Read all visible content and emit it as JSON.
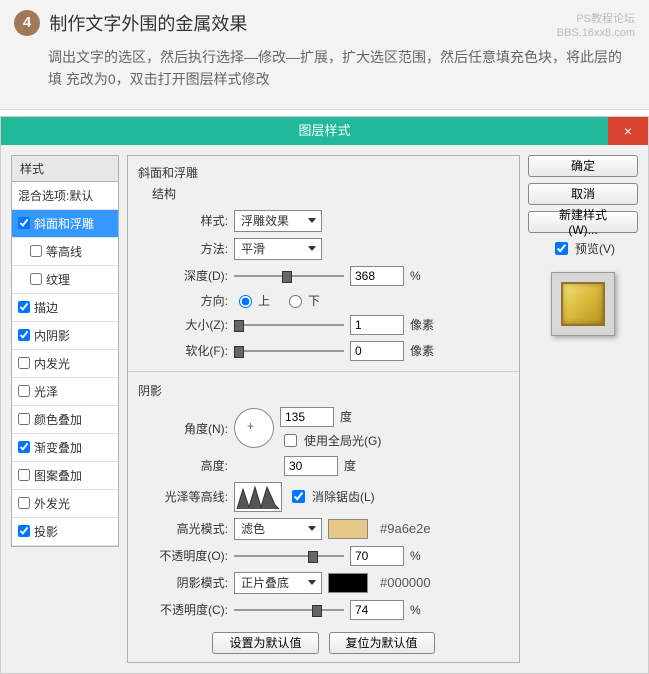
{
  "header": {
    "step_num": "4",
    "title": "制作文字外围的金属效果",
    "desc": "调出文字的选区，然后执行选择—修改—扩展，扩大选区范围，然后任意填充色块，将此层的填 充改为0，双击打开图层样式修改",
    "watermark1": "PS教程论坛",
    "watermark2": "BBS.16xx8.com"
  },
  "dialog": {
    "title": "图层样式",
    "close": "×"
  },
  "left": {
    "header": "样式",
    "blend": "混合选项:默认",
    "items": [
      {
        "label": "斜面和浮雕",
        "checked": true,
        "selected": true
      },
      {
        "label": "等高线",
        "checked": false,
        "sub": true
      },
      {
        "label": "纹理",
        "checked": false,
        "sub": true
      },
      {
        "label": "描边",
        "checked": true
      },
      {
        "label": "内阴影",
        "checked": true
      },
      {
        "label": "内发光",
        "checked": false
      },
      {
        "label": "光泽",
        "checked": false
      },
      {
        "label": "颜色叠加",
        "checked": false
      },
      {
        "label": "渐变叠加",
        "checked": true
      },
      {
        "label": "图案叠加",
        "checked": false
      },
      {
        "label": "外发光",
        "checked": false
      },
      {
        "label": "投影",
        "checked": true
      }
    ]
  },
  "center": {
    "section": "斜面和浮雕",
    "struct_label": "结构",
    "style_label": "样式:",
    "style_value": "浮雕效果",
    "method_label": "方法:",
    "method_value": "平滑",
    "depth_label": "深度(D):",
    "depth_value": "368",
    "percent": "%",
    "dir_label": "方向:",
    "dir_up": "上",
    "dir_down": "下",
    "size_label": "大小(Z):",
    "size_value": "1",
    "px": "像素",
    "soften_label": "软化(F):",
    "soften_value": "0",
    "shadow_label": "阴影",
    "angle_label": "角度(N):",
    "angle_value": "135",
    "deg": "度",
    "global_light": "使用全局光(G)",
    "altitude_label": "高度:",
    "altitude_value": "30",
    "gloss_label": "光泽等高线:",
    "antialias": "消除锯齿(L)",
    "highlight_mode_label": "高光模式:",
    "highlight_mode_value": "滤色",
    "highlight_hex": "#9a6e2e",
    "highlight_opacity_label": "不透明度(O):",
    "highlight_opacity_value": "70",
    "shadow_mode_label": "阴影模式:",
    "shadow_mode_value": "正片叠底",
    "shadow_hex": "#000000",
    "shadow_opacity_label": "不透明度(C):",
    "shadow_opacity_value": "74",
    "set_default": "设置为默认值",
    "reset_default": "复位为默认值"
  },
  "right": {
    "ok": "确定",
    "cancel": "取消",
    "new_style": "新建样式(W)...",
    "preview": "预览(V)"
  }
}
